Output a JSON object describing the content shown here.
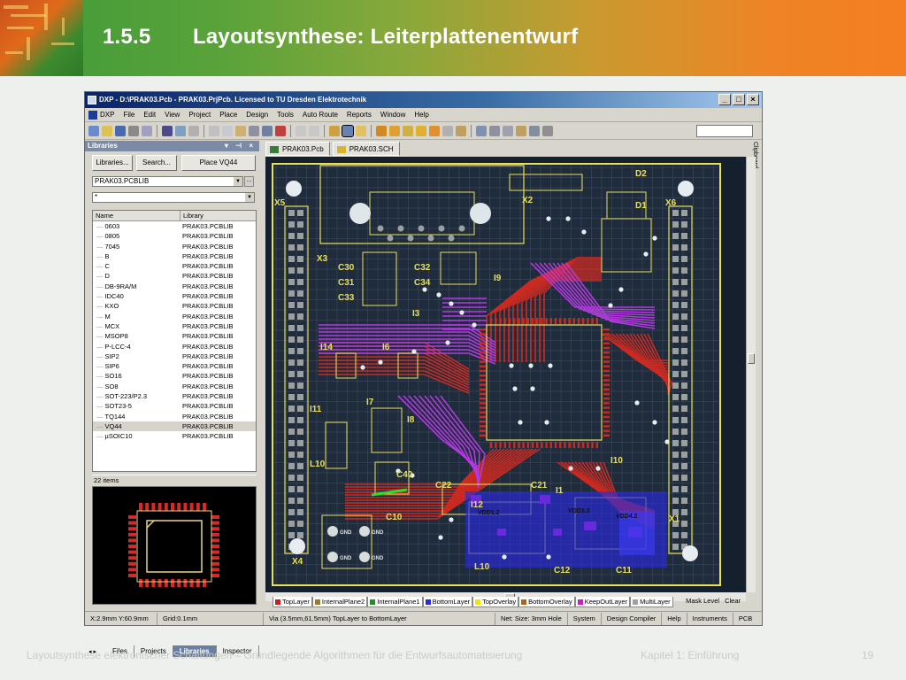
{
  "slide": {
    "number": "1.5.5",
    "title": "Layoutsynthese: Leiterplattenentwurf",
    "footer_left": "Layoutsynthese elektronischer Schaltungen – Grundlegende Algorithmen für die Entwurfsautomatisierung",
    "footer_chapter": "Kapitel 1: Einführung",
    "page": "19"
  },
  "window": {
    "title": "DXP - D:\\PRAK03.Pcb - PRAK03.PrjPcb. Licensed to TU Dresden Elektrotechnik",
    "controls": [
      "_",
      "□",
      "×"
    ]
  },
  "menu": [
    "DXP",
    "File",
    "Edit",
    "View",
    "Project",
    "Place",
    "Design",
    "Tools",
    "Auto Route",
    "Reports",
    "Window",
    "Help"
  ],
  "libraries_panel": {
    "title": "Libraries",
    "libraries_button": "Libraries...",
    "search_button": "Search...",
    "place_button": "Place VQ44",
    "library_selected": "PRAK03.PCBLIB",
    "filter_value": "*",
    "columns": [
      "Name",
      "Library"
    ],
    "items": [
      {
        "name": "0603",
        "lib": "PRAK03.PCBLIB"
      },
      {
        "name": "0805",
        "lib": "PRAK03.PCBLIB"
      },
      {
        "name": "7045",
        "lib": "PRAK03.PCBLIB"
      },
      {
        "name": "B",
        "lib": "PRAK03.PCBLIB"
      },
      {
        "name": "C",
        "lib": "PRAK03.PCBLIB"
      },
      {
        "name": "D",
        "lib": "PRAK03.PCBLIB"
      },
      {
        "name": "DB-9RA/M",
        "lib": "PRAK03.PCBLIB"
      },
      {
        "name": "IDC40",
        "lib": "PRAK03.PCBLIB"
      },
      {
        "name": "KXO",
        "lib": "PRAK03.PCBLIB"
      },
      {
        "name": "M",
        "lib": "PRAK03.PCBLIB"
      },
      {
        "name": "MCX",
        "lib": "PRAK03.PCBLIB"
      },
      {
        "name": "MSOP8",
        "lib": "PRAK03.PCBLIB"
      },
      {
        "name": "P-LCC-4",
        "lib": "PRAK03.PCBLIB"
      },
      {
        "name": "SIP2",
        "lib": "PRAK03.PCBLIB"
      },
      {
        "name": "SIP6",
        "lib": "PRAK03.PCBLIB"
      },
      {
        "name": "SO16",
        "lib": "PRAK03.PCBLIB"
      },
      {
        "name": "SO8",
        "lib": "PRAK03.PCBLIB"
      },
      {
        "name": "SOT-223/P2.3",
        "lib": "PRAK03.PCBLIB"
      },
      {
        "name": "SOT23-5",
        "lib": "PRAK03.PCBLIB"
      },
      {
        "name": "TQ144",
        "lib": "PRAK03.PCBLIB"
      },
      {
        "name": "VQ44",
        "lib": "PRAK03.PCBLIB",
        "selected": true
      },
      {
        "name": "µSOIC10",
        "lib": "PRAK03.PCBLIB"
      }
    ],
    "count": "22 items",
    "tabs": [
      "Files",
      "Projects",
      "Libraries",
      "Inspector"
    ],
    "active_tab": "Libraries"
  },
  "documents": [
    "PRAK03.Pcb",
    "PRAK03.SCH"
  ],
  "clipboard_label": "Clipboard",
  "pcb_labels": {
    "connectors": [
      "X5",
      "X2",
      "X6",
      "X3",
      "X4",
      "X1",
      "D2",
      "D1"
    ],
    "parts": [
      "C30",
      "C32",
      "C33",
      "C34",
      "C31",
      "I3",
      "I9",
      "I14",
      "I6",
      "I11",
      "I7",
      "I8",
      "L10",
      "C22",
      "C21",
      "C10",
      "C40",
      "C12",
      "C11",
      "I10",
      "I12",
      "I13",
      "L10b",
      "C35",
      "C9"
    ],
    "misc": [
      "VDD1.2",
      "VDD3.3",
      "VDD4.2",
      "GND",
      "GND",
      "GND",
      "GND",
      "R22",
      "R21"
    ]
  },
  "layers": [
    {
      "name": "TopLayer",
      "color": "#c8201a"
    },
    {
      "name": "InternalPlane2",
      "color": "#9a7a2a"
    },
    {
      "name": "InternalPlane1",
      "color": "#2a8a2a"
    },
    {
      "name": "BottomLayer",
      "color": "#2a2adc"
    },
    {
      "name": "TopOverlay",
      "color": "#e8e800"
    },
    {
      "name": "BottomOverlay",
      "color": "#a86818"
    },
    {
      "name": "KeepOutLayer",
      "color": "#d01ad0"
    },
    {
      "name": "MultiLayer",
      "color": "#a0a0a0"
    }
  ],
  "layer_right": [
    "Mask Level",
    "Clear"
  ],
  "status": {
    "coords": "X:2.9mm Y:60.9mm",
    "grid": "Grid:0.1mm",
    "message": "Via (3.5mm,61.5mm) TopLayer to BottomLayer",
    "net": "Net: Size: 3mm Hole",
    "panels": [
      "System",
      "Design Compiler",
      "Help",
      "Instruments",
      "PCB"
    ]
  },
  "colors": {
    "board": "#1f2c3c",
    "track_top": "#cc2a20",
    "track_bottom": "#b23ae0",
    "overlay": "#e8e05a",
    "pad": "#9aa0a0",
    "grid": "#5a5a7a"
  }
}
